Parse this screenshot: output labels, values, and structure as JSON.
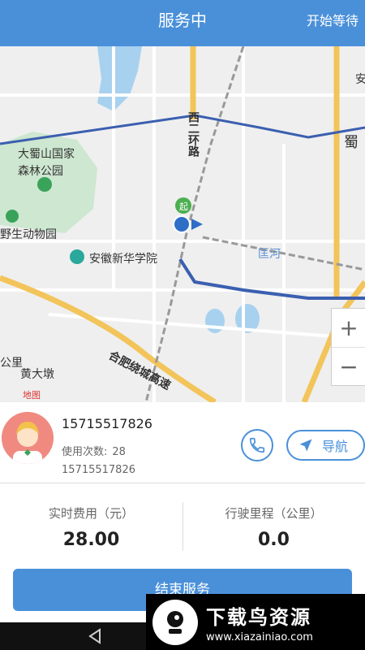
{
  "header": {
    "title": "服务中",
    "action_label": "开始等待"
  },
  "map": {
    "labels": {
      "daxiangshan": "大蜀山国家",
      "forest_park": "森林公园",
      "wildlife_park": "野生动物园",
      "xinhua_college": "安徽新华学院",
      "second_ring": "西二环路",
      "ring_expressway": "合肥绕城高速",
      "huangdadun": "黄大墩",
      "river": "匡河",
      "km_label": "公里",
      "shu": "蜀",
      "an": "安",
      "start_marker": "起",
      "baidu": "地图"
    },
    "zoom_in": "+",
    "zoom_out": "−",
    "colors": {
      "route": "#3b5fb0",
      "road_yellow": "#f2c45a",
      "park_green": "#cde7d0",
      "water": "#a8d1ef"
    }
  },
  "customer": {
    "phone": "15715517826",
    "usage_label": "使用次数:",
    "usage_count": "28",
    "phone_secondary": "15715517826",
    "call_icon": "phone-icon",
    "nav_icon": "navigation-arrow-icon",
    "nav_label": "导航"
  },
  "stats": {
    "fee_label": "实时费用（元）",
    "fee_value": "28.00",
    "distance_label": "行驶里程（公里）",
    "distance_value": "0.0"
  },
  "end_button": "结束服务",
  "watermark": {
    "title": "下载鸟资源",
    "url": "www.xiazainiao.com"
  },
  "theme": {
    "primary": "#4a90d9"
  }
}
